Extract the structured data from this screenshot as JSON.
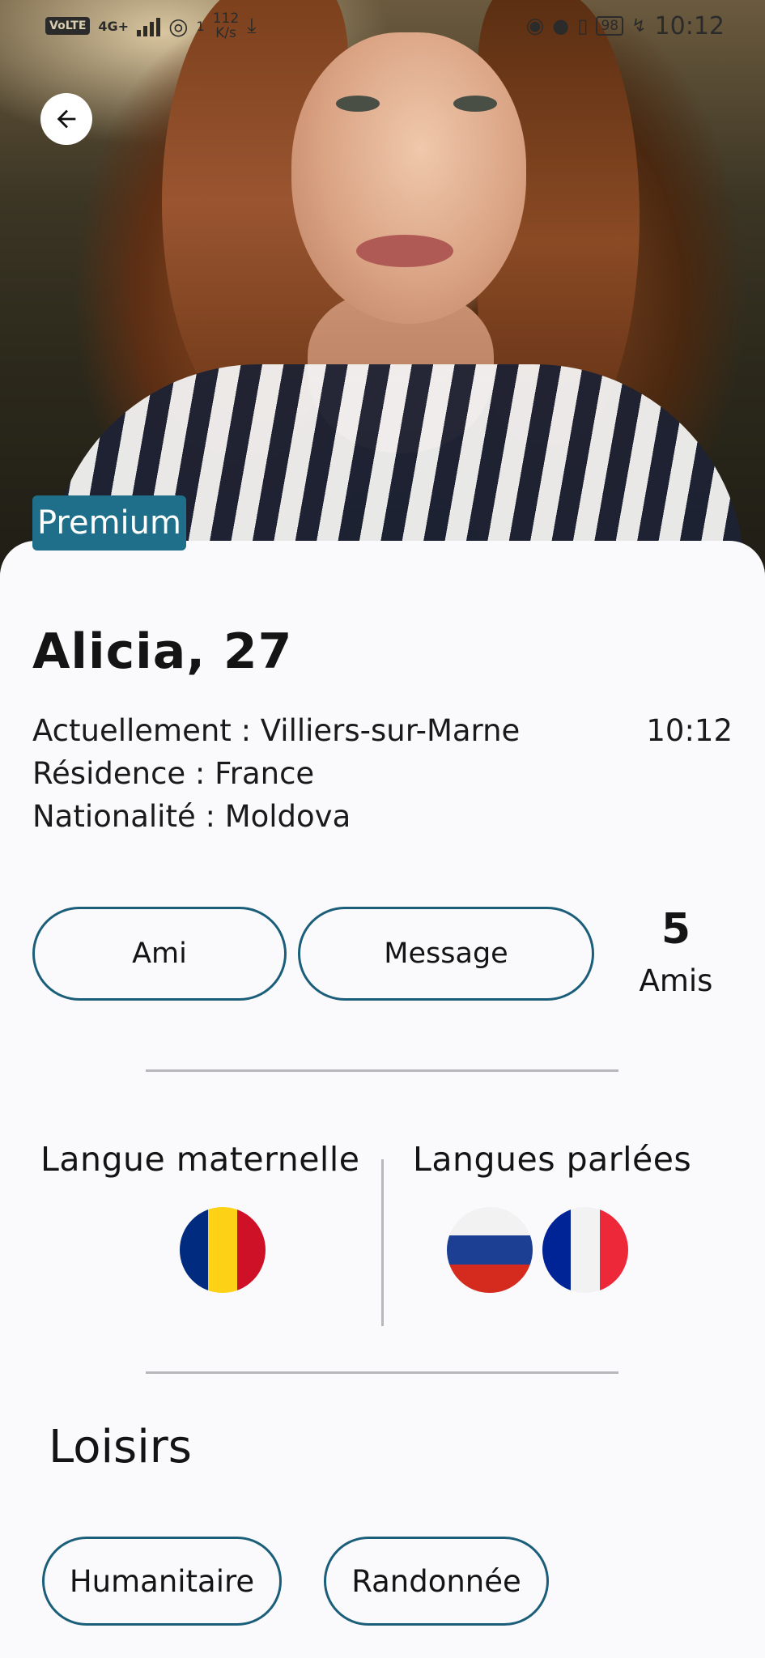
{
  "status_bar": {
    "volte": "VoLTE",
    "network": "4G+",
    "hotspot_count": "1",
    "speed_value": "112",
    "speed_unit": "K/s",
    "battery": "98",
    "time": "10:12"
  },
  "header": {
    "back_icon": "arrow-left-icon",
    "badge": "Premium"
  },
  "profile": {
    "name": "Alicia, 27",
    "current_location": "Actuellement : Villiers-sur-Marne",
    "residence": "Résidence : France",
    "nationality": "Nationalité : Moldova",
    "local_time": "10:12"
  },
  "actions": {
    "friend_label": "Ami",
    "message_label": "Message",
    "friends_count": "5",
    "friends_label": "Amis"
  },
  "languages": {
    "native_title": "Langue maternelle",
    "spoken_title": "Langues parlées",
    "native": [
      {
        "flag": "romania-flag-icon",
        "colors": [
          "#002b7f",
          "#fcd116",
          "#ce1126"
        ]
      }
    ],
    "spoken": [
      {
        "flag": "russia-flag-icon",
        "colors": [
          "#ffffff",
          "#1c3f94",
          "#d52b1e"
        ]
      },
      {
        "flag": "france-flag-icon",
        "colors": [
          "#002395",
          "#ffffff",
          "#ed2939"
        ]
      }
    ]
  },
  "hobbies": {
    "title": "Loisirs",
    "items": [
      "Humanitaire",
      "Randonnée"
    ]
  },
  "colors": {
    "accent": "#1b5e79",
    "badge_bg": "#1f6f8b"
  }
}
